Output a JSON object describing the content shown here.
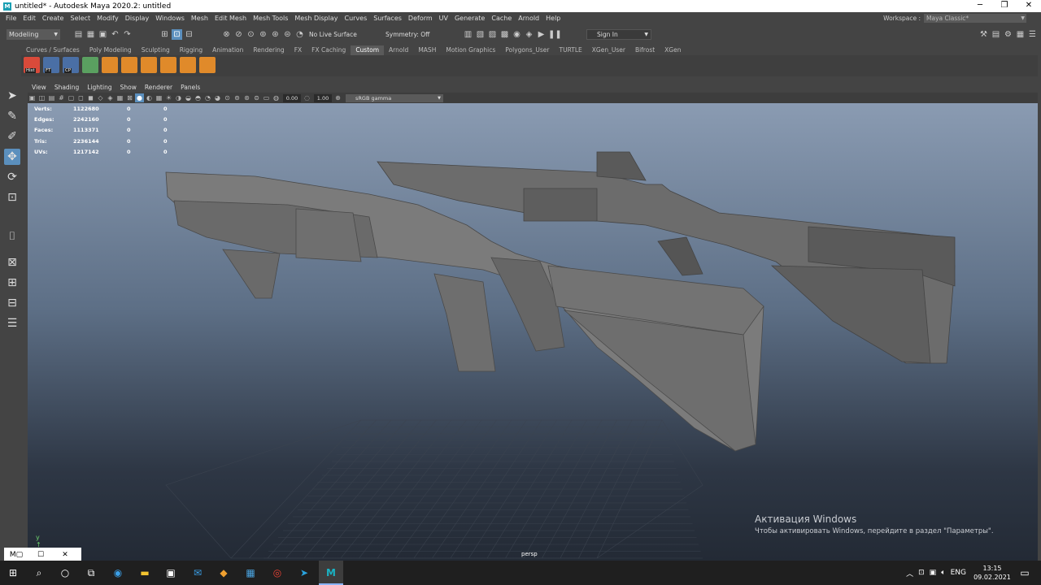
{
  "window": {
    "title": "untitled* - Autodesk Maya 2020.2: untitled",
    "app_icon": "M"
  },
  "menu": [
    "File",
    "Edit",
    "Create",
    "Select",
    "Modify",
    "Display",
    "Windows",
    "Mesh",
    "Edit Mesh",
    "Mesh Tools",
    "Mesh Display",
    "Curves",
    "Surfaces",
    "Deform",
    "UV",
    "Generate",
    "Cache",
    "Arnold",
    "Help"
  ],
  "workspace": {
    "label": "Workspace :",
    "value": "Maya Classic*"
  },
  "statusline": {
    "mode": "Modeling",
    "live_surface": "No Live Surface",
    "symmetry": "Symmetry: Off",
    "sign_in": "Sign In"
  },
  "shelf_tabs": [
    "Curves / Surfaces",
    "Poly Modeling",
    "Sculpting",
    "Rigging",
    "Animation",
    "Rendering",
    "FX",
    "FX Caching",
    "Custom",
    "Arnold",
    "MASH",
    "Motion Graphics",
    "Polygons_User",
    "TURTLE",
    "XGen_User",
    "Bifrost",
    "XGen"
  ],
  "active_shelf_tab": "Custom",
  "shelf_icons": [
    {
      "name": "hist-icon",
      "label": "Hist",
      "color": "#d94a3a"
    },
    {
      "name": "freeze-transform-icon",
      "label": "FT",
      "color": "#4a6fa5"
    },
    {
      "name": "center-pivot-icon",
      "label": "CP",
      "color": "#4a6fa5"
    },
    {
      "name": "poly-plane-icon",
      "label": "",
      "color": "#5aa060"
    },
    {
      "name": "poly-ball-icon",
      "label": "",
      "color": "#e08a2a"
    },
    {
      "name": "poly-extrude-icon",
      "label": "",
      "color": "#e08a2a"
    },
    {
      "name": "poly-bevel-icon",
      "label": "",
      "color": "#e08a2a"
    },
    {
      "name": "poly-combine-icon",
      "label": "",
      "color": "#e08a2a"
    },
    {
      "name": "poly-separate-icon",
      "label": "",
      "color": "#e08a2a"
    },
    {
      "name": "poly-cube-icon",
      "label": "",
      "color": "#e08a2a"
    }
  ],
  "panel_menu": [
    "View",
    "Shading",
    "Lighting",
    "Show",
    "Renderer",
    "Panels"
  ],
  "panel_values": {
    "exposure": "0.00",
    "gamma": "1.00",
    "color_space": "sRGB gamma"
  },
  "hud": [
    {
      "label": "Verts:",
      "a": "1122680",
      "b": "0",
      "c": "0"
    },
    {
      "label": "Edges:",
      "a": "2242160",
      "b": "0",
      "c": "0"
    },
    {
      "label": "Faces:",
      "a": "1113371",
      "b": "0",
      "c": "0"
    },
    {
      "label": "Tris:",
      "a": "2236144",
      "b": "0",
      "c": "0"
    },
    {
      "label": "UVs:",
      "a": "1217142",
      "b": "0",
      "c": "0"
    }
  ],
  "camera": "persp",
  "activation": {
    "title": "Активация Windows",
    "text": "Чтобы активировать Windows, перейдите в раздел \"Параметры\"."
  },
  "taskbar": {
    "lang": "ENG",
    "time": "13:15",
    "date": "09.02.2021"
  }
}
